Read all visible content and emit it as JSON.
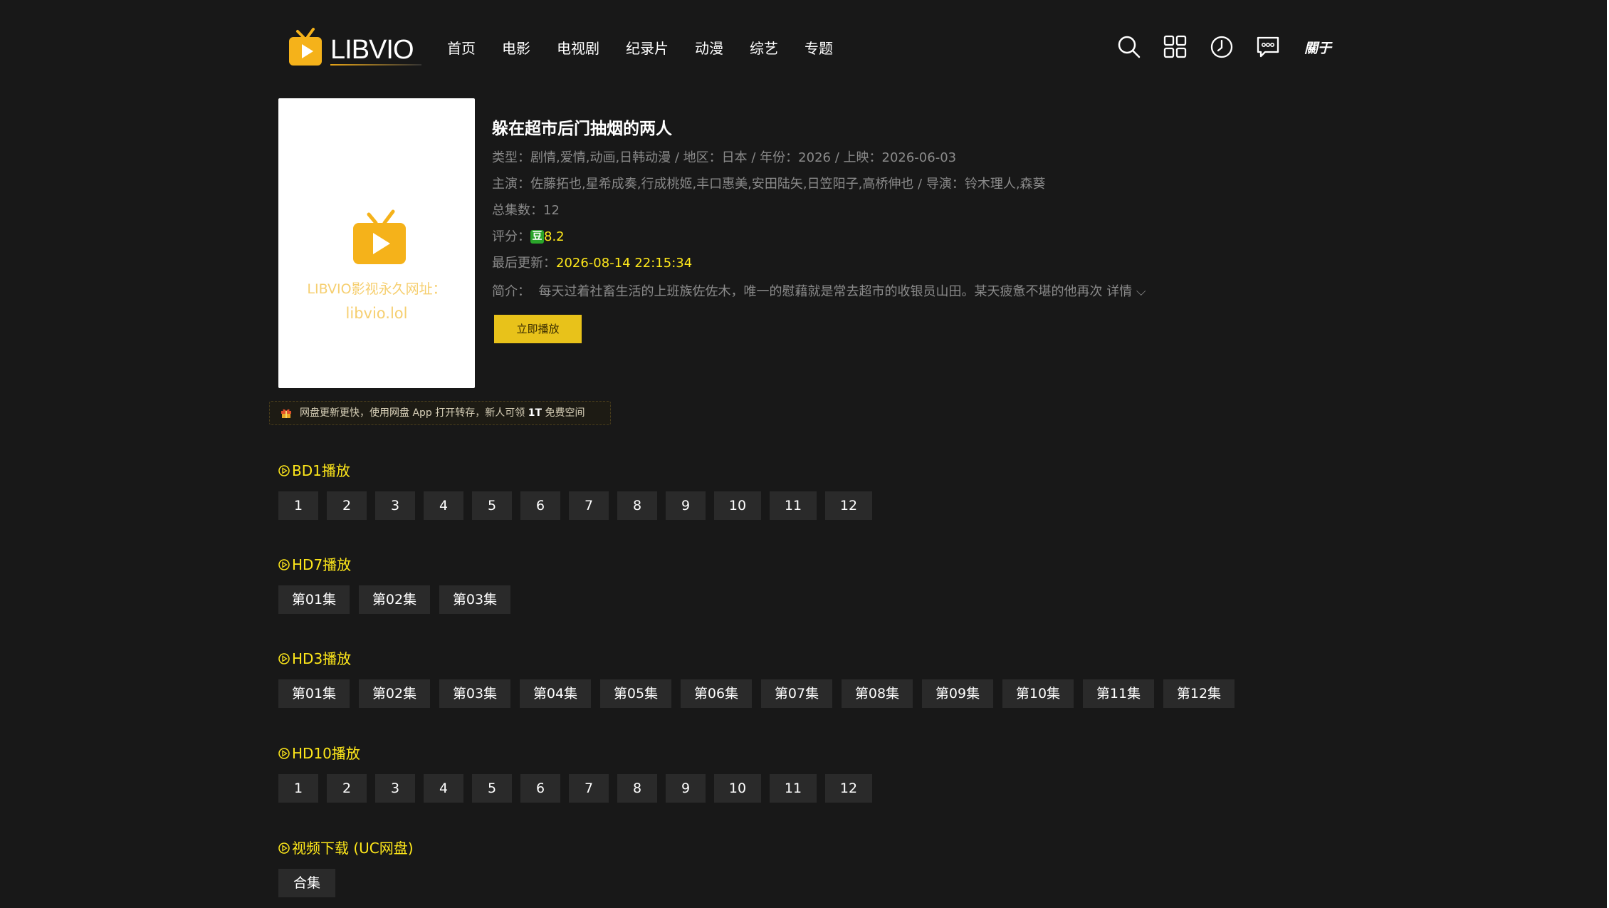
{
  "header": {
    "logo_text": "LIBVIO",
    "nav": [
      "首页",
      "电影",
      "电视剧",
      "纪录片",
      "动漫",
      "综艺",
      "专题"
    ],
    "icons": [
      "search-icon",
      "grid-icon",
      "history-icon",
      "message-icon"
    ],
    "about": "關于"
  },
  "poster": {
    "line1": "LIBVIO影视永久网址：",
    "line2": "libvio.lol"
  },
  "detail": {
    "title": "躲在超市后门抽烟的两人",
    "type_line": "类型：剧情,爱情,动画,日韩动漫 / 地区：日本 / 年份：2026 / 上映：2026-06-03",
    "cast_line": "主演：佐藤拓也,星希成奏,行成桃姬,丰口惠美,安田陆矢,日笠阳子,高桥伸也 / 导演：铃木理人,森葵",
    "episodes_line": "总集数：12",
    "rating_label": "评分：",
    "rating_badge": "豆",
    "rating_value": "8.2",
    "updated_label": "最后更新：",
    "updated_value": "2026-08-14 22:15:34",
    "intro_label": "简介：",
    "intro_text": "每天过着社畜生活的上班族佐佐木，唯一的慰藉就是常去超市的收银员山田。某天疲惫不堪的他再次",
    "detail_link": "详情 ⌵",
    "play_button": "立即播放"
  },
  "promo": {
    "text_before": "网盘更新更快，使用网盘 App 打开转存，新人可领 ",
    "highlight": "1T",
    "text_after": " 免费空间"
  },
  "sources": [
    {
      "title": "BD1播放",
      "episodes": [
        "1",
        "2",
        "3",
        "4",
        "5",
        "6",
        "7",
        "8",
        "9",
        "10",
        "11",
        "12"
      ]
    },
    {
      "title": "HD7播放",
      "episodes": [
        "第01集",
        "第02集",
        "第03集"
      ]
    },
    {
      "title": "HD3播放",
      "episodes": [
        "第01集",
        "第02集",
        "第03集",
        "第04集",
        "第05集",
        "第06集",
        "第07集",
        "第08集",
        "第09集",
        "第10集",
        "第11集",
        "第12集"
      ]
    },
    {
      "title": "HD10播放",
      "episodes": [
        "1",
        "2",
        "3",
        "4",
        "5",
        "6",
        "7",
        "8",
        "9",
        "10",
        "11",
        "12"
      ]
    },
    {
      "title": "视频下载 (UC网盘)",
      "episodes": [
        "合集"
      ]
    }
  ],
  "colors": {
    "background": "#181818",
    "accent_yellow": "#ffe81a",
    "button_yellow": "#e8c21a",
    "episode_bg": "#2a2a2a",
    "meta_text": "#8a8a8a"
  }
}
